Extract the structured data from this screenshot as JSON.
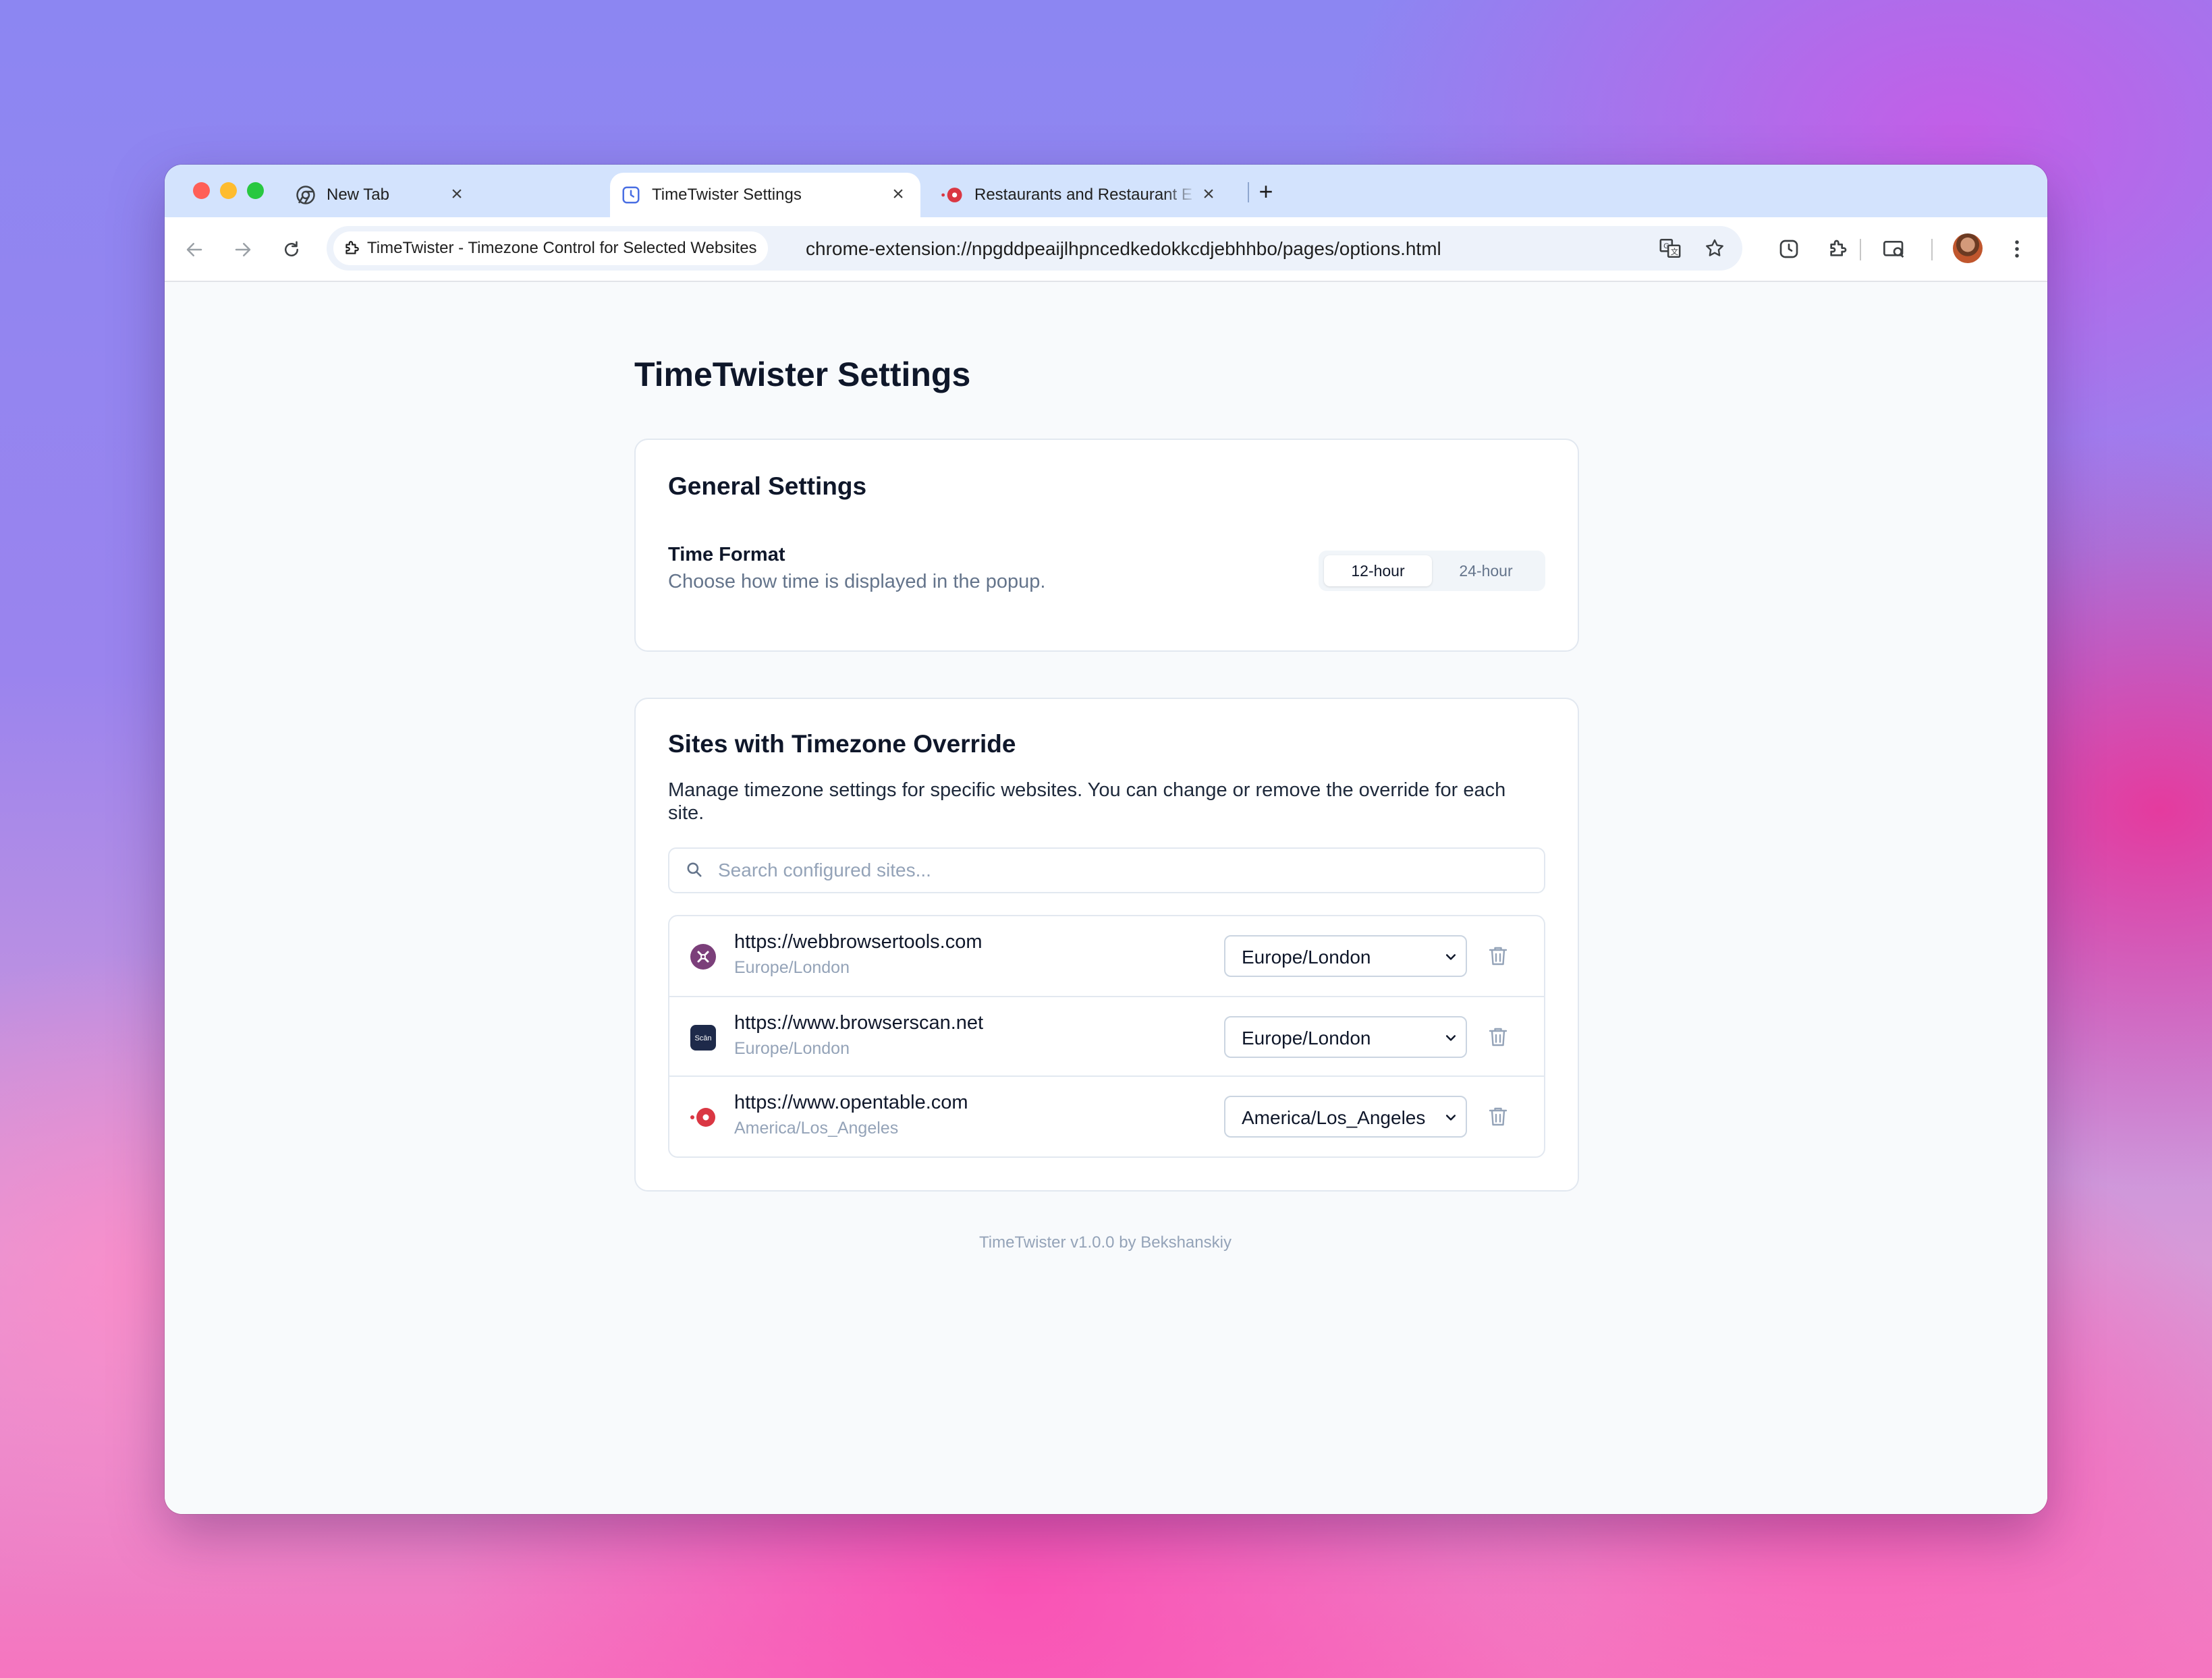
{
  "browser": {
    "tabs": [
      {
        "title": "New Tab",
        "active": false
      },
      {
        "title": "TimeTwister Settings",
        "active": true
      },
      {
        "title": "Restaurants and Restaurant E",
        "active": false
      }
    ],
    "extension_chip": "TimeTwister - Timezone Control for Selected Websites",
    "url": "chrome-extension://npgddpeaijlhpncedkedokkcdjebhhbo/pages/options.html"
  },
  "page": {
    "title": "TimeTwister Settings",
    "general": {
      "heading": "General Settings",
      "time_format_label": "Time Format",
      "time_format_desc": "Choose how time is displayed in the popup.",
      "options": [
        "12-hour",
        "24-hour"
      ],
      "selected": "12-hour"
    },
    "sites": {
      "heading": "Sites with Timezone Override",
      "description": "Manage timezone settings for specific websites. You can change or remove the override for each site.",
      "search_placeholder": "Search configured sites...",
      "list": [
        {
          "url": "https://webbrowsertools.com",
          "timezone": "Europe/London",
          "selected": "Europe/London",
          "favicon": "webbrowsertools-favicon"
        },
        {
          "url": "https://www.browserscan.net",
          "timezone": "Europe/London",
          "selected": "Europe/London",
          "favicon": "browserscan-favicon"
        },
        {
          "url": "https://www.opentable.com",
          "timezone": "America/Los_Angeles",
          "selected": "America/Los_Angeles",
          "favicon": "opentable-favicon"
        }
      ]
    },
    "footer": "TimeTwister v1.0.0 by Bekshanskiy"
  },
  "colors": {
    "tabbar": "#d3e3fd",
    "page_bg": "#f8fafc",
    "text_primary": "#0f172a",
    "text_muted": "#64748b",
    "opentable_red": "#da3743",
    "browserscan_dark": "#1e2a4a",
    "webbrowsertools_purple": "#7b3f7a"
  }
}
